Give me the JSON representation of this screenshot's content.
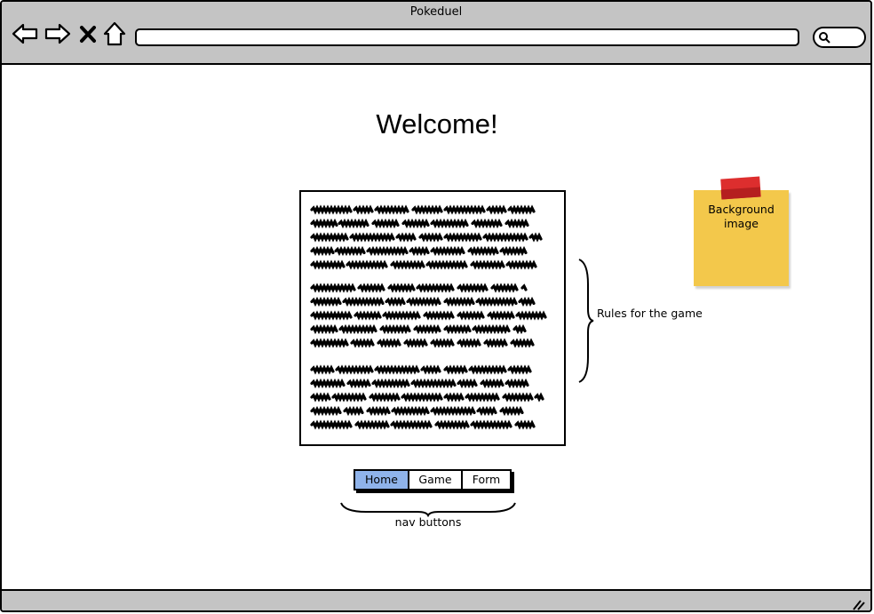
{
  "window": {
    "title": "Pokeduel"
  },
  "toolbar": {
    "icons": [
      "back-arrow-icon",
      "forward-arrow-icon",
      "close-x-icon",
      "home-icon"
    ],
    "address_value": "",
    "search_value": ""
  },
  "main": {
    "heading": "Welcome!",
    "rules_annotation": "Rules for the game",
    "sticky_note": {
      "text": "Background image"
    },
    "nav": {
      "buttons": [
        {
          "label": "Home",
          "active": true
        },
        {
          "label": "Game",
          "active": false
        },
        {
          "label": "Form",
          "active": false
        }
      ],
      "annotation": "nav buttons"
    }
  },
  "colors": {
    "chrome": "#c4c4c4",
    "active_button": "#8fb3ea",
    "sticky_note": "#f3c84b",
    "tape": "#dd2e2e"
  }
}
